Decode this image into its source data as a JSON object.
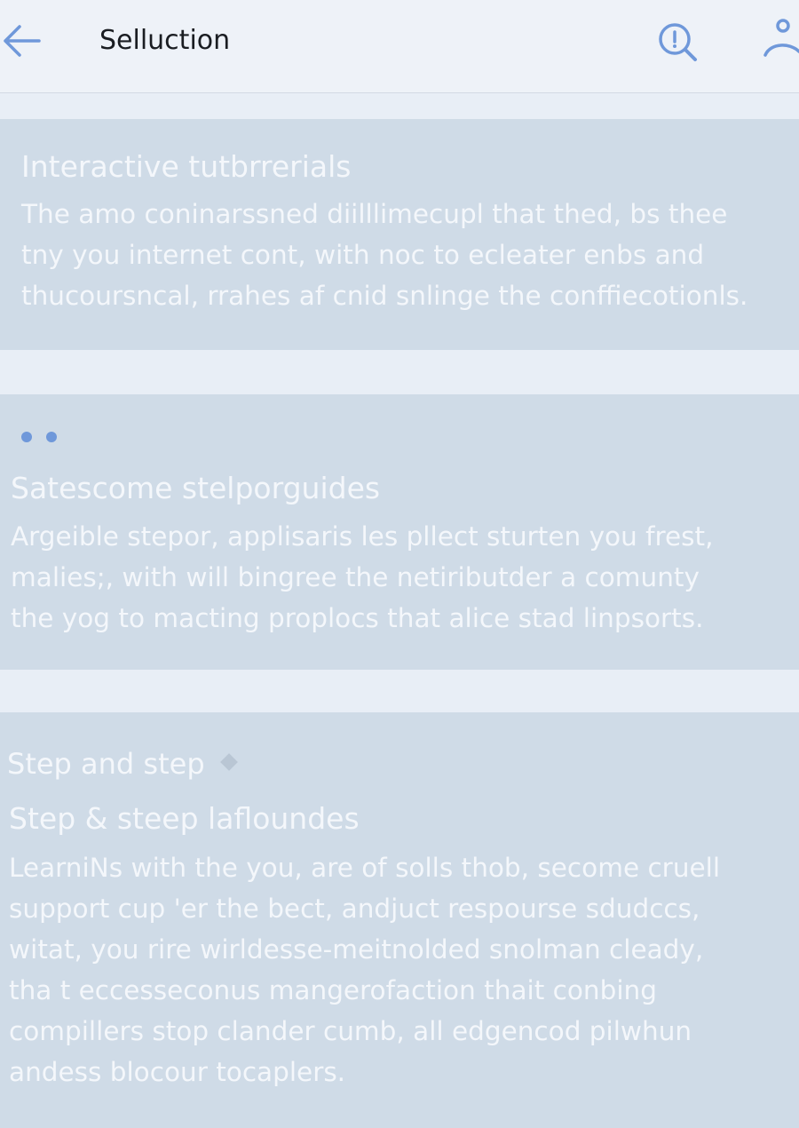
{
  "header": {
    "title": "Selluction",
    "back_icon": "arrow-left-icon",
    "search_icon": "search-icon",
    "profile_icon": "user-icon"
  },
  "colors": {
    "accent": "#6f98da",
    "card_bg": "#cfdbe7",
    "page_bg": "#e8eef6"
  },
  "sections": [
    {
      "title": "Interactive tutbrrerials",
      "body_lines": [
        "The amo coninarssned diilllimecupl that thed, bs thee",
        "tny you internet cont, with noc to ecleater enbs and",
        "thucoursncal, rrahes af cnid snlinge the conffiecotionls."
      ]
    },
    {
      "title": "Satescome stelporguides",
      "body_lines": [
        "Argeible stepor, applisaris les pllect sturten you frest,",
        "malies;, with will bingree the netiributder a comunty",
        "the yog to macting proplocs that alice stad linpsorts."
      ]
    },
    {
      "label": "Step and step",
      "title": "Step & steep lafloundes",
      "body_lines": [
        "LearniNs with the you, are of solls thob, secome cruell",
        "support cup 'er the bect, andjuct respourse sdudccs,",
        "witat, you rire wirldesse-meitnolded snolman cleady,",
        "tha t eccesseconus mangerofaction thait conbing",
        "compillers stop clander cumb, all edgencod pilwhun",
        "andess blocour tocaplers."
      ]
    }
  ]
}
